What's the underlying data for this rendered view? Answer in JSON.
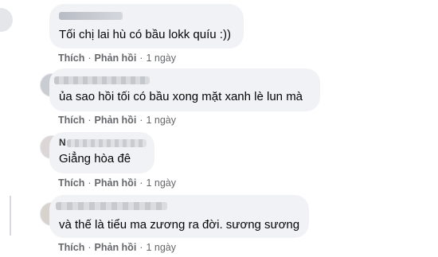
{
  "comments": [
    {
      "author_partial": "",
      "text": "Tối chị lai hù có bầu lokk quíu :))",
      "like": "Thích",
      "reply": "Phản hồi",
      "time": "1 ngày"
    },
    {
      "author_partial": "",
      "text": "ủa sao hồi tối có bầu xong mặt xanh lè lun mà",
      "like": "Thích",
      "reply": "Phản hồi",
      "time": "1 ngày"
    },
    {
      "author_partial": "N",
      "text": "Giẳng hòa đê",
      "like": "Thích",
      "reply": "Phản hồi",
      "time": "1 ngày"
    },
    {
      "author_partial": "",
      "text": "và thế là tiểu ma zương ra đời. sương sương",
      "like": "Thích",
      "reply": "Phản hồi",
      "time": "1 ngày"
    }
  ],
  "colors": {
    "bubble": "#f0f2f5",
    "action_text": "#65676b",
    "text": "#050505"
  }
}
